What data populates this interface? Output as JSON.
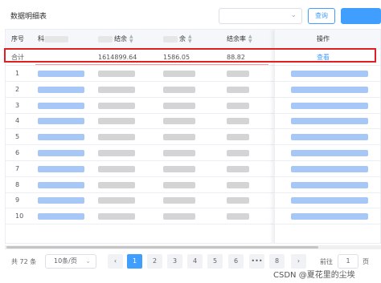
{
  "header": {
    "title": "数据明细表",
    "select_value": "",
    "chevron_icon": "chevron-down-icon",
    "query_label": "查询",
    "accent_color": "#409eff"
  },
  "table": {
    "columns": [
      {
        "label": "序号"
      },
      {
        "label": "科"
      },
      {
        "label": "结余"
      },
      {
        "label": "余"
      },
      {
        "label": "结余率"
      },
      {
        "label": "操作"
      }
    ],
    "summary_row": {
      "label": "合计",
      "col2": "1614899.64",
      "col3": "1586.05",
      "col4": "88.82",
      "action": "查看"
    },
    "row_numbers": [
      "1",
      "2",
      "3",
      "4",
      "5",
      "6",
      "7",
      "8",
      "9",
      "10"
    ]
  },
  "pagination": {
    "total": "共 72 条",
    "page_size": "10条/页",
    "prev_icon": "chevron-left-icon",
    "next_icon": "chevron-right-icon",
    "pages": [
      "1",
      "2",
      "3",
      "4",
      "5",
      "6",
      "•••",
      "8"
    ],
    "current_page": "1",
    "goto_label": "前往",
    "goto_value": "1",
    "goto_suffix": "页"
  },
  "watermark": "CSDN @夏花里的尘埃"
}
